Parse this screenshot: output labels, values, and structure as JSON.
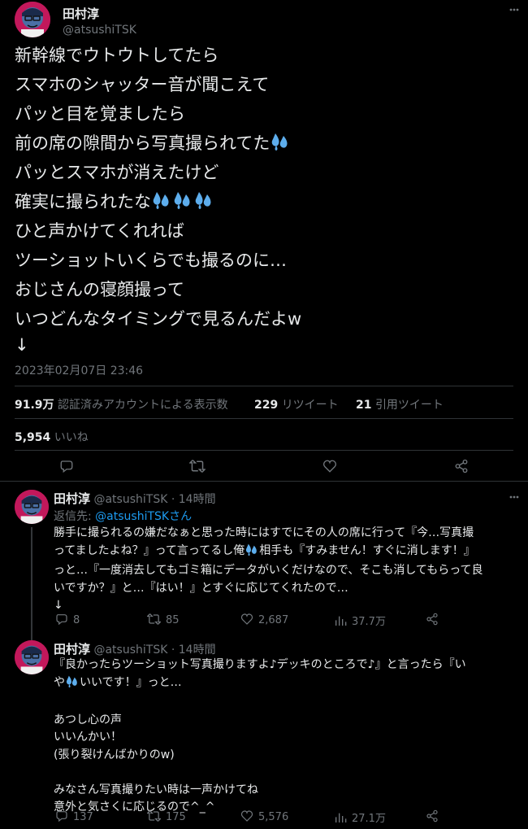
{
  "colors": {
    "background": "#000000",
    "text": "#e7e9ea",
    "muted": "#71767b",
    "link": "#1d9bf0",
    "divider": "#2f3336",
    "avatar_bg": "#c2185b"
  },
  "main_tweet": {
    "author_name": "田村淳",
    "author_handle": "@atsushiTSK",
    "lines": [
      "新幹線でウトウトしてたら",
      "スマホのシャッター音が聞こえて",
      "パッと目を覚ましたら",
      "前の席の隙間から写真撮られてた",
      "パッとスマホが消えたけど",
      "確実に撮られたな",
      "ひと声かけてくれれば",
      "ツーショットいくらでも撮るのに…",
      "おじさんの寝顔撮って",
      "いつどんなタイミングで見るんだよw",
      "↓"
    ],
    "emoji_icon": "sweat-droplets-icon",
    "timestamp": "2023年02月07日 23:46",
    "views_count": "91.9万",
    "views_label": "認証済みアカウントによる表示数",
    "retweets_count": "229",
    "retweets_label": "リツイート",
    "quotes_count": "21",
    "quotes_label": "引用ツイート",
    "likes_count": "5,954",
    "likes_label": "いいね"
  },
  "replies": [
    {
      "author_name": "田村淳",
      "author_handle": "@atsushiTSK",
      "time": "14時間",
      "reply_to_label": "返信先: ",
      "reply_to_handle": "@atsushiTSKさん",
      "lines": [
        "勝手に撮られるの嫌だなぁと思った時にはすでにその人の席に行って『今…写真撮",
        "ってましたよね？』って言ってるし俺",
        "相手も『すみません！すぐに消します！』",
        "っと…『一度消去してもゴミ箱にデータがいくだけなので、そこも消してもらって良",
        "いですか？』と…『はい！』とすぐに応じてくれたので…",
        "↓"
      ],
      "replies_count": "8",
      "retweets_count": "85",
      "likes_count": "2,687",
      "views_count": "37.7万"
    },
    {
      "author_name": "田村淳",
      "author_handle": "@atsushiTSK",
      "time": "14時間",
      "lines": [
        "『良かったらツーショット写真撮りますよ♪デッキのところで♪』と言ったら『い",
        "や",
        "いいです！』っと…",
        "",
        "あつし心の声",
        "いいんかい！",
        "(張り裂けんばかりのw)",
        "",
        "みなさん写真撮りたい時は一声かけてね",
        "意外と気さくに応じるので^_^"
      ],
      "replies_count": "137",
      "retweets_count": "175",
      "likes_count": "5,576",
      "views_count": "27.1万"
    }
  ]
}
